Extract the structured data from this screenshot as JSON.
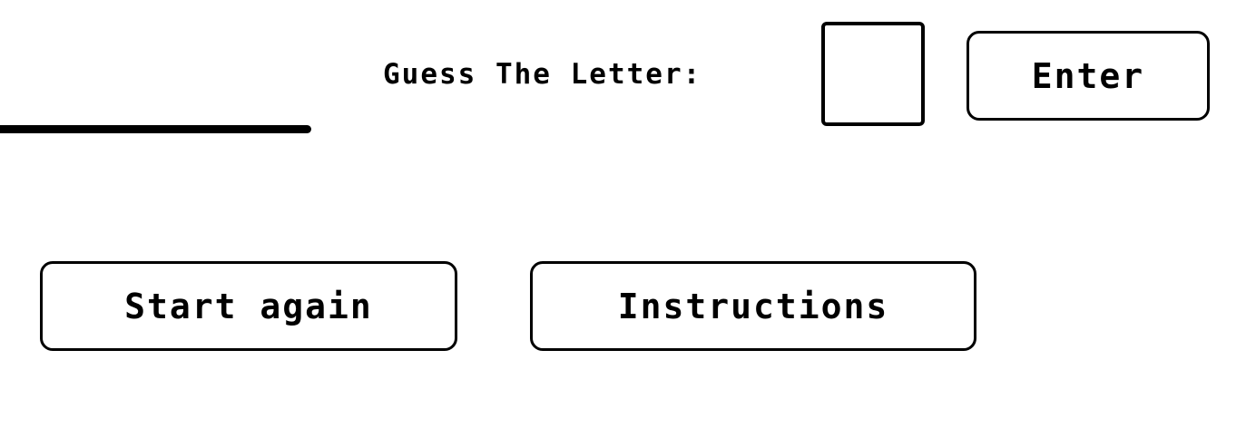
{
  "game": {
    "guess_label": "Guess The Letter:",
    "letter_value": ""
  },
  "buttons": {
    "enter_label": "Enter",
    "start_again_label": "Start again",
    "instructions_label": "Instructions"
  }
}
